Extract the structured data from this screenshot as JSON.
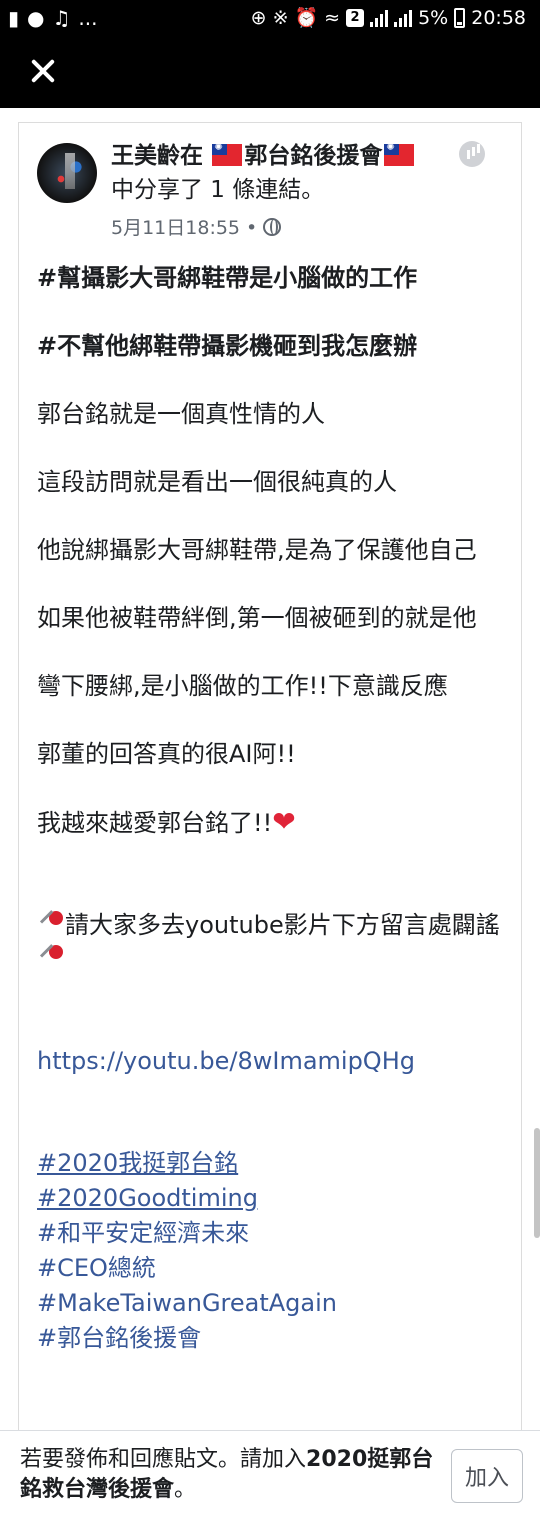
{
  "status_bar": {
    "left_icons": [
      "alert-icon",
      "chat-icon",
      "music-icon"
    ],
    "left_ellipsis": "...",
    "sim_badge": "2",
    "battery": "5%",
    "time": "20:58"
  },
  "post": {
    "author": "王美齡在",
    "group": "郭台銘後援會",
    "action": "中分享了 1 條連結。",
    "timestamp": "5月11日18:55 •",
    "paragraphs": [
      {
        "text": "#幫攝影大哥綁鞋帶是小腦做的工作",
        "bold": true
      },
      {
        "text": "#不幫他綁鞋帶攝影機砸到我怎麼辦",
        "bold": true
      },
      {
        "text": "郭台銘就是一個真性情的人"
      },
      {
        "text": "這段訪問就是看出一個很純真的人"
      },
      {
        "text": "他說綁攝影大哥綁鞋帶,是為了保護他自己"
      },
      {
        "text": "如果他被鞋帶絆倒,第一個被砸到的就是他"
      },
      {
        "text": "彎下腰綁,是小腦做的工作!!下意識反應"
      },
      {
        "text": "郭董的回答真的很AI阿!!"
      },
      {
        "text": "我越來越愛郭台銘了!!"
      }
    ],
    "call_to_action": "請大家多去youtube影片下方留言處闢謠",
    "link": "https://youtu.be/8wImamipQHg",
    "hashtags": [
      "#2020我挺郭台銘",
      "#2020Goodtiming",
      "#和平安定經濟未來",
      "#CEO總統",
      "#MakeTaiwanGreatAgain",
      "#郭台銘後援會"
    ]
  },
  "footer": {
    "prompt_prefix": "若要發佈和回應貼文。請加入",
    "group_name": "2020挺郭台銘救台灣後援會",
    "prompt_suffix": "。",
    "join_label": "加入"
  }
}
